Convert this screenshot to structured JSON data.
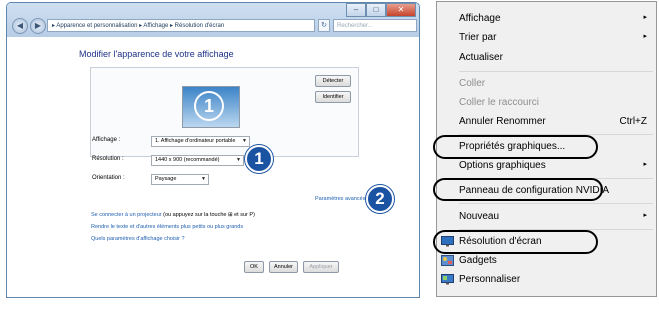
{
  "window": {
    "title_buttons": [
      "–",
      "□",
      "✕"
    ],
    "nav": [
      "◀",
      "▶"
    ],
    "address": "▸ Apparence et personnalisation ▸ Affichage ▸ Résolution d'écran",
    "refresh": "↻",
    "search_placeholder": "Rechercher...",
    "page_title": "Modifier l'apparence de votre affichage",
    "detect_label": "Détecter",
    "identify_label": "Identifier",
    "monitor_number": "1",
    "fields": {
      "display_label": "Affichage :",
      "display_value": "1. Affichage d'ordinateur portable",
      "resolution_label": "Résolution :",
      "resolution_value": "1440 x 900 (recommandé)",
      "orientation_label": "Orientation :",
      "orientation_value": "Paysage"
    },
    "advanced_link": "Paramètres avancés",
    "link_projector": "Se connecter à un projecteur",
    "link_projector_hint": "(ou appuyez sur la touche ⊞ et sur P)",
    "link_text_size": "Rendre le texte et d'autres éléments plus petits ou plus grands",
    "link_which_settings": "Quels paramètres d'affichage choisir ?",
    "ok_label": "OK",
    "cancel_label": "Annuler",
    "apply_label": "Appliquer",
    "badge1": "1",
    "badge2": "2"
  },
  "menu": {
    "items": [
      {
        "label": "Affichage",
        "submenu": "▸"
      },
      {
        "label": "Trier par",
        "submenu": "▸"
      },
      {
        "label": "Actualiser"
      },
      {
        "label": "Coller"
      },
      {
        "label": "Coller le raccourci"
      },
      {
        "label": "Annuler Renommer",
        "shortcut": "Ctrl+Z"
      },
      {
        "label": "Propriétés graphiques..."
      },
      {
        "label": "Options graphiques",
        "submenu": "▸"
      },
      {
        "label": "Panneau de configuration NVIDIA"
      },
      {
        "label": "Nouveau",
        "submenu": "▸"
      },
      {
        "label": "Résolution d'écran"
      },
      {
        "label": "Gadgets"
      },
      {
        "label": "Personnaliser"
      }
    ]
  },
  "colors": {
    "link": "#1f5fb0",
    "title": "#1e3287",
    "badge": "#1b53a3",
    "menu_bg": "#f0f0f0",
    "disabled": "#8e8e8e"
  }
}
